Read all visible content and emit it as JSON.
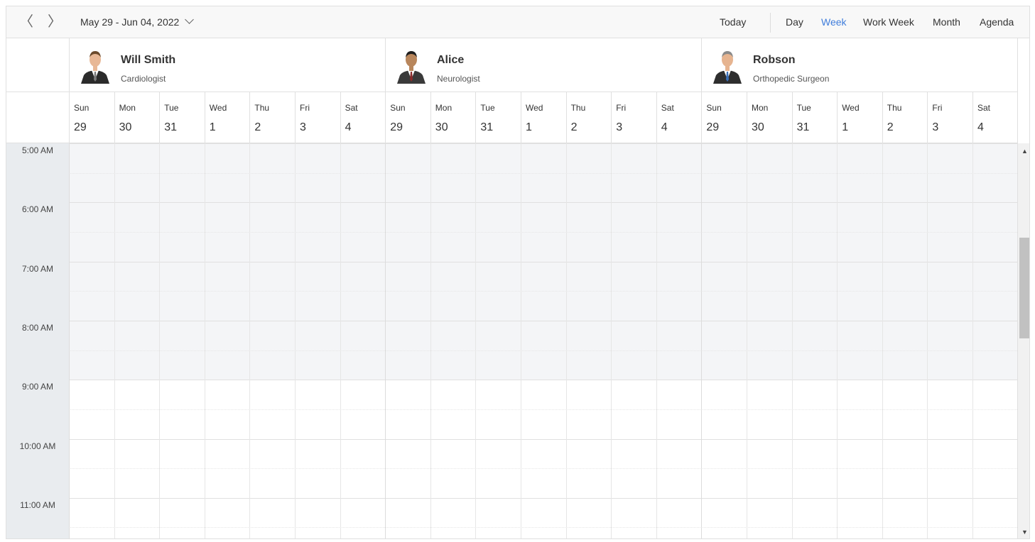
{
  "toolbar": {
    "prev_icon": "〈",
    "next_icon": "〉",
    "date_range": "May 29 - Jun 04, 2022",
    "today": "Today",
    "views": [
      "Day",
      "Week",
      "Work Week",
      "Month",
      "Agenda"
    ],
    "active_view": "Week",
    "accent_color": "#3f7ddb"
  },
  "resources": [
    {
      "name": "Will Smith",
      "designation": "Cardiologist"
    },
    {
      "name": "Alice",
      "designation": "Neurologist"
    },
    {
      "name": "Robson",
      "designation": "Orthopedic Surgeon"
    }
  ],
  "days": [
    {
      "name": "Sun",
      "date": "29"
    },
    {
      "name": "Mon",
      "date": "30"
    },
    {
      "name": "Tue",
      "date": "31"
    },
    {
      "name": "Wed",
      "date": "1"
    },
    {
      "name": "Thu",
      "date": "2"
    },
    {
      "name": "Fri",
      "date": "3"
    },
    {
      "name": "Sat",
      "date": "4"
    }
  ],
  "time_slots": [
    "5:00 AM",
    "6:00 AM",
    "7:00 AM",
    "8:00 AM",
    "9:00 AM",
    "10:00 AM",
    "11:00 AM"
  ],
  "work_hours_start": "9:00 AM",
  "colors": {
    "off_hours": "#f4f5f7",
    "work_hours": "#ffffff",
    "time_column": "#e9ecef"
  }
}
